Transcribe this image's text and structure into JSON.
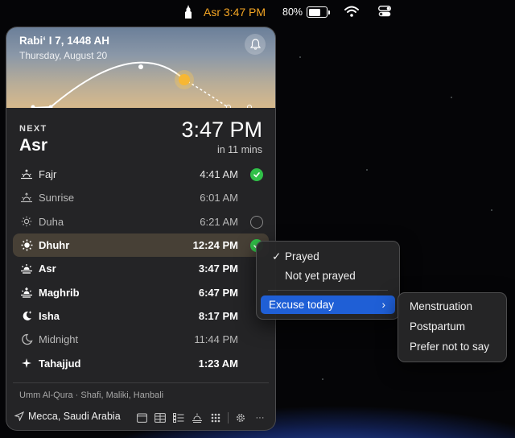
{
  "menubar": {
    "prayer_status": "Asr 3:47 PM",
    "battery_percent": "80%",
    "battery_level": 0.8,
    "accent": "#f5a623"
  },
  "panel": {
    "hijri_date": "Rabiʻ I 7, 1448 AH",
    "gregorian_date": "Thursday, August 20",
    "next_label": "NEXT",
    "next_prayer": "Asr",
    "next_time": "3:47 PM",
    "next_countdown": "in 11 mins",
    "prayers": [
      {
        "name": "Fajr",
        "time": "4:41 AM",
        "icon": "sunrise-icon",
        "status": "prayed"
      },
      {
        "name": "Sunrise",
        "time": "6:01 AM",
        "icon": "sunrise-icon",
        "status": "none"
      },
      {
        "name": "Duha",
        "time": "6:21 AM",
        "icon": "sun-small-icon",
        "status": "empty"
      },
      {
        "name": "Dhuhr",
        "time": "12:24 PM",
        "icon": "sun-icon",
        "status": "prayed"
      },
      {
        "name": "Asr",
        "time": "3:47 PM",
        "icon": "sun-haze-icon",
        "status": "none"
      },
      {
        "name": "Maghrib",
        "time": "6:47 PM",
        "icon": "sunset-icon",
        "status": "none"
      },
      {
        "name": "Isha",
        "time": "8:17 PM",
        "icon": "moon-star-icon",
        "status": "none"
      },
      {
        "name": "Midnight",
        "time": "11:44 PM",
        "icon": "moon-icon",
        "status": "none"
      },
      {
        "name": "Tahajjud",
        "time": "1:23 AM",
        "icon": "sparkle-icon",
        "status": "none"
      }
    ],
    "calc_method": "Umm Al-Qura · Shafi, Maliki, Hanbali",
    "location": "Mecca, Saudi Arabia",
    "more": "···"
  },
  "status_menu": {
    "prayed": "Prayed",
    "not_prayed": "Not yet prayed",
    "excuse": "Excuse today",
    "checkmark": "✓",
    "arrow": "›"
  },
  "excuse_menu": {
    "items": [
      "Menstruation",
      "Postpartum",
      "Prefer not to say"
    ]
  },
  "colors": {
    "prayed_green": "#30c048",
    "selection_blue": "#1f5fd6"
  }
}
